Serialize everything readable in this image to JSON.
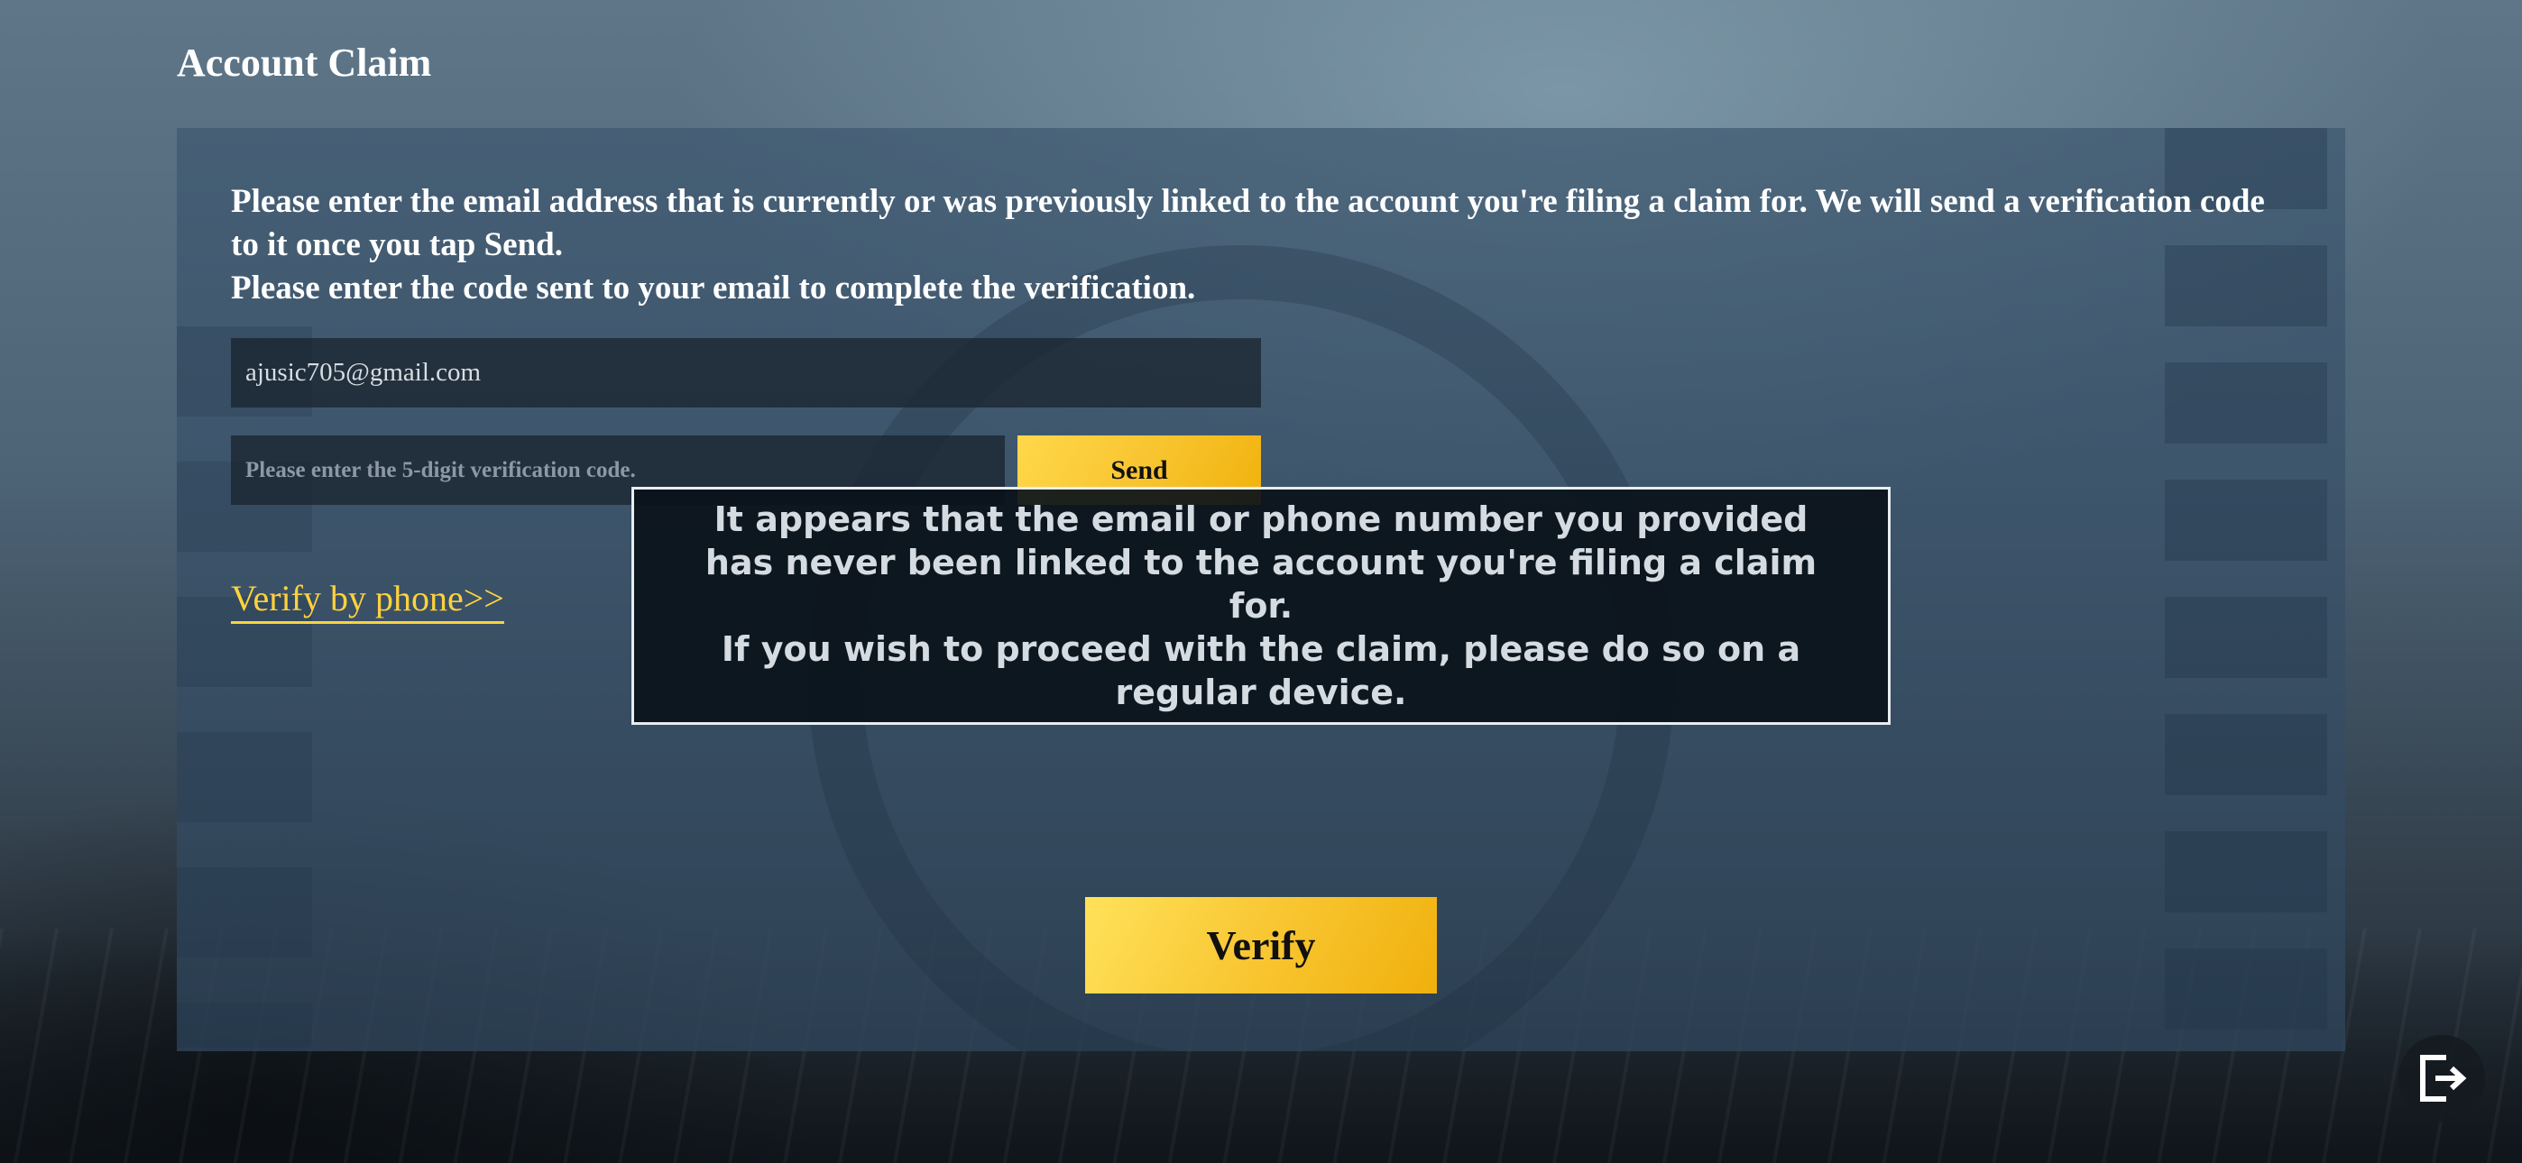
{
  "header": {
    "title": "Account Claim"
  },
  "form": {
    "instruction_line1": "Please enter the email address that is currently or was previously linked to the account you're filing a claim for. We will send a verification code to it once you tap Send.",
    "instruction_line2": "Please enter the code sent to your email to complete the verification.",
    "email_value": "ajusic705@gmail.com",
    "code_placeholder": "Please enter the 5-digit verification code.",
    "send_label": "Send",
    "verify_phone_link": "Verify by phone>>",
    "verify_label": "Verify"
  },
  "toast": {
    "line1": "It appears that the email or phone number you provided has never been linked to the account you're filing a claim for.",
    "line2": "If you wish to proceed with the claim, please do so on a regular device."
  },
  "icons": {
    "exit": "exit-icon"
  },
  "colors": {
    "accent": "#f8c531",
    "link": "#ffd23c"
  }
}
